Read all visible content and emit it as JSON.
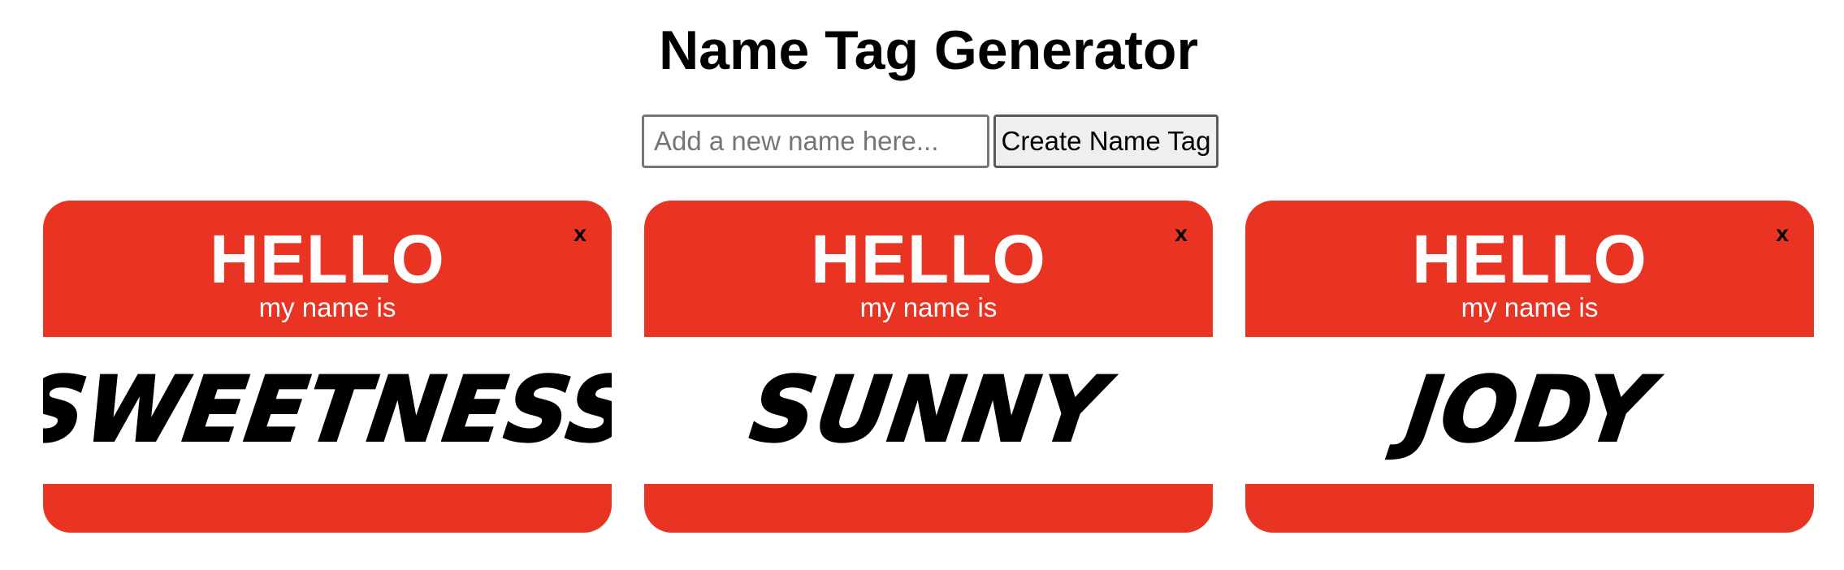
{
  "header": {
    "title": "Name Tag Generator"
  },
  "form": {
    "input_value": "",
    "input_placeholder": "Add a new name here...",
    "button_label": "Create Name Tag"
  },
  "tags": [
    {
      "greeting": "HELLO",
      "subtitle": "my name is",
      "name": "Sweetness",
      "close_label": "x"
    },
    {
      "greeting": "HELLO",
      "subtitle": "my name is",
      "name": "Sunny",
      "close_label": "x"
    },
    {
      "greeting": "HELLO",
      "subtitle": "my name is",
      "name": "Jody",
      "close_label": "x"
    }
  ],
  "colors": {
    "tag_red": "#e93323",
    "tag_text": "#ffffff",
    "name_text": "#000000"
  },
  "icons": {
    "close": "close-icon"
  }
}
